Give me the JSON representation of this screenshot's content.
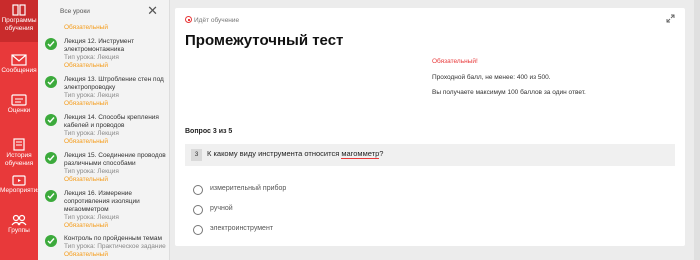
{
  "nav": {
    "items": [
      {
        "label1": "Программы",
        "label2": "обучения",
        "icon": "book-icon"
      },
      {
        "label1": "Сообщения",
        "label2": "",
        "icon": "mail-icon"
      },
      {
        "label1": "Оценки",
        "label2": "",
        "icon": "grades-icon"
      },
      {
        "label1": "История",
        "label2": "обучения",
        "icon": "history-icon"
      },
      {
        "label1": "Мероприятия",
        "label2": "",
        "icon": "events-icon"
      },
      {
        "label1": "Группы",
        "label2": "",
        "icon": "groups-icon"
      }
    ],
    "colors": {
      "primary": "#e8393a",
      "active": "#c92b2c"
    }
  },
  "lessons": {
    "title": "Все уроки",
    "top_required": "Обязательный",
    "items": [
      {
        "title": "Лекция 12. Инструмент электромонтажника",
        "type": "Тип урока: Лекция",
        "required": "Обязательный"
      },
      {
        "title": "Лекция 13. Штробление стен под электропроводку",
        "type": "Тип урока: Лекция",
        "required": "Обязательный"
      },
      {
        "title": "Лекция 14. Способы крепления кабелей и проводов",
        "type": "Тип урока: Лекция",
        "required": "Обязательный"
      },
      {
        "title": "Лекция 15. Соединение проводов различными способами",
        "type": "Тип урока: Лекция",
        "required": "Обязательный"
      },
      {
        "title": "Лекция 16. Измерение сопротивления изоляции мегаомметром",
        "type": "Тип урока: Лекция",
        "required": "Обязательный"
      },
      {
        "title": "Контроль по пройденным темам",
        "type": "Тип урока: Практическое задание",
        "required": "Обязательный"
      }
    ]
  },
  "main": {
    "status": "Идёт обучение",
    "title": "Промежуточный тест",
    "required_note": "Обязательный!",
    "pass_score": "Проходной балл, не менее: 400 из 500.",
    "max_score": "Вы получаете максимум 100 баллов за один ответ.",
    "question_counter": "Вопрос 3 из 5",
    "question": {
      "number": "3",
      "text_before": "К какому виду инструмента относится ",
      "text_highlight": "магомметр",
      "text_after": "?"
    },
    "options": [
      "измерительный прибор",
      "ручной",
      "электроинструмент"
    ]
  }
}
